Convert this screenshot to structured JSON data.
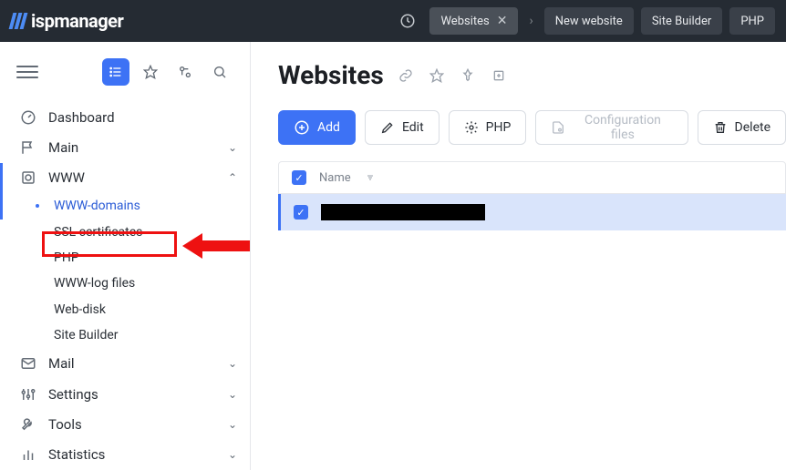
{
  "brand": "ispmanager",
  "breadcrumbs": [
    {
      "label": "Websites",
      "closable": true,
      "active": true
    },
    {
      "label": "New website",
      "closable": false
    },
    {
      "label": "Site Builder",
      "closable": false
    },
    {
      "label": "PHP",
      "closable": false
    }
  ],
  "sidebar": {
    "items": [
      {
        "label": "Dashboard",
        "icon": "gauge"
      },
      {
        "label": "Main",
        "icon": "flag",
        "expandable": true,
        "expanded": false
      },
      {
        "label": "WWW",
        "icon": "globe",
        "expandable": true,
        "expanded": true,
        "active": true,
        "children": [
          {
            "label": "WWW-domains",
            "current": true
          },
          {
            "label": "SSL certificates"
          },
          {
            "label": "PHP"
          },
          {
            "label": "WWW-log files"
          },
          {
            "label": "Web-disk"
          },
          {
            "label": "Site Builder"
          }
        ]
      },
      {
        "label": "Mail",
        "icon": "mail",
        "expandable": true
      },
      {
        "label": "Settings",
        "icon": "sliders",
        "expandable": true
      },
      {
        "label": "Tools",
        "icon": "wrench",
        "expandable": true
      },
      {
        "label": "Statistics",
        "icon": "bars",
        "expandable": true
      }
    ]
  },
  "page": {
    "title": "Websites",
    "toolbar": {
      "add_label": "Add",
      "edit_label": "Edit",
      "php_label": "PHP",
      "config_label": "Configuration files",
      "delete_label": "Delete"
    },
    "columns": {
      "name": "Name"
    },
    "rows": [
      {
        "name": "█████████████"
      }
    ]
  }
}
